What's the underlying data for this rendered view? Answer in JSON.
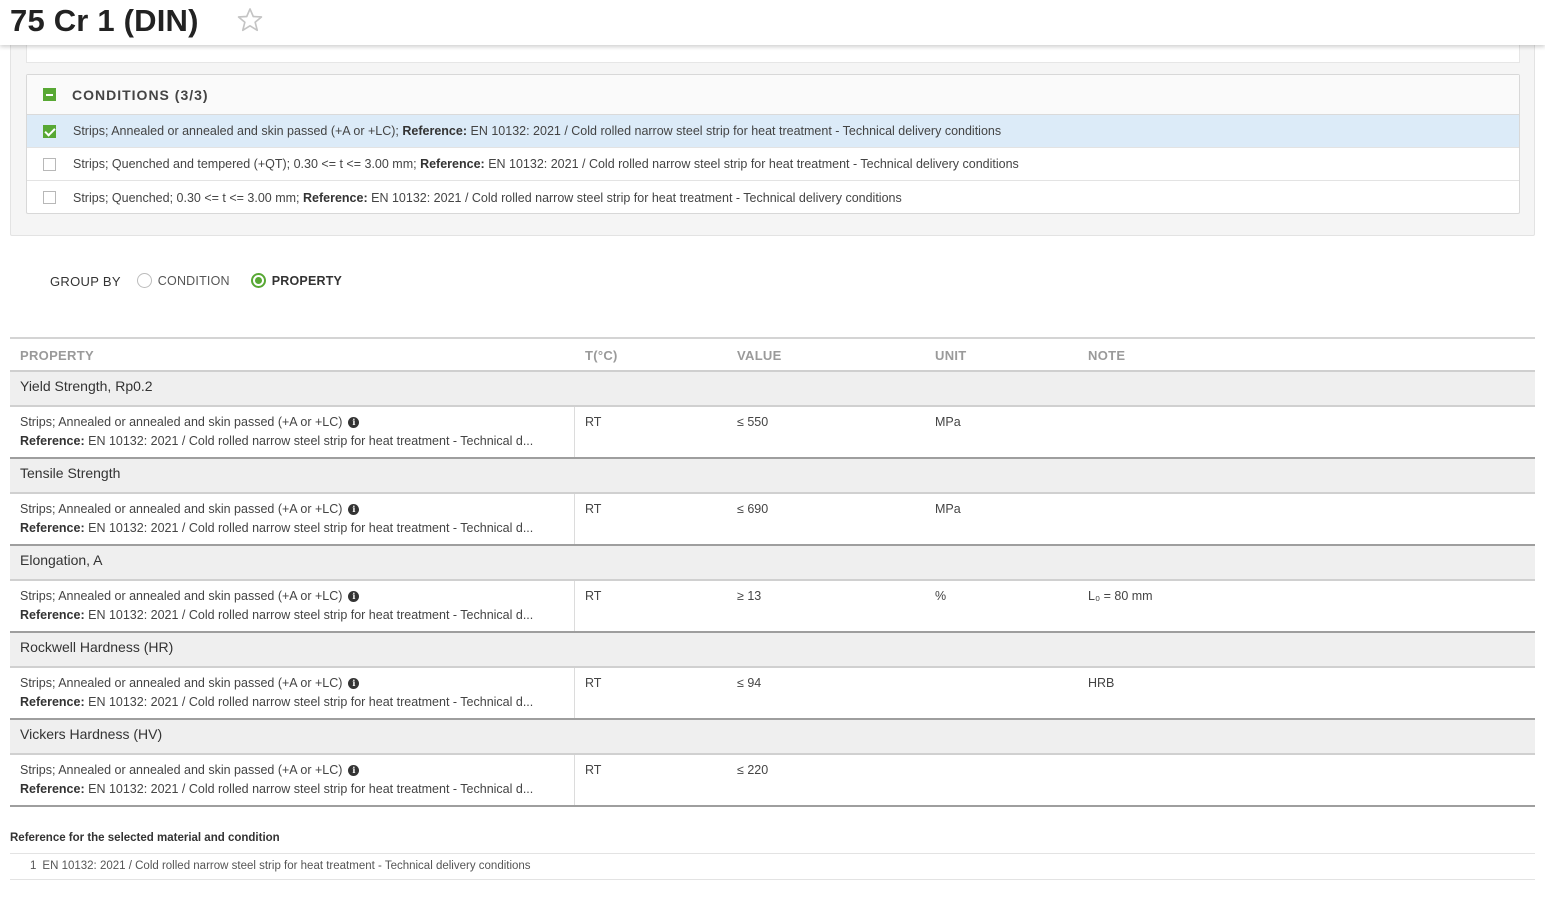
{
  "header": {
    "title": "75 Cr 1 (DIN)",
    "favorite_icon": "star-outline-icon"
  },
  "conditions": {
    "title": "CONDITIONS (3/3)",
    "reference_label": "Reference:",
    "items": [
      {
        "text": "Strips; Annealed or annealed and skin passed (+A or +LC);",
        "reference": "EN 10132: 2021 / Cold rolled narrow steel strip for heat treatment - Technical delivery conditions",
        "checked": true
      },
      {
        "text": "Strips; Quenched and tempered (+QT); 0.30 <= t <= 3.00 mm;",
        "reference": "EN 10132: 2021 / Cold rolled narrow steel strip for heat treatment - Technical delivery conditions",
        "checked": false
      },
      {
        "text": "Strips; Quenched; 0.30 <= t <= 3.00 mm;",
        "reference": "EN 10132: 2021 / Cold rolled narrow steel strip for heat treatment - Technical delivery conditions",
        "checked": false
      }
    ]
  },
  "group_by": {
    "label": "GROUP BY",
    "options": [
      "CONDITION",
      "PROPERTY"
    ],
    "selected": "PROPERTY"
  },
  "table": {
    "headers": {
      "property": "PROPERTY",
      "temp": "T(°C)",
      "value": "VALUE",
      "unit": "UNIT",
      "note": "NOTE"
    },
    "condition_text": "Strips; Annealed or annealed and skin passed (+A or +LC)",
    "reference_label": "Reference:",
    "reference_text": "EN 10132: 2021 / Cold rolled narrow steel strip for heat treatment - Technical d...",
    "groups": [
      {
        "name": "Yield Strength, Rp0.2",
        "temp": "RT",
        "value": "≤ 550",
        "unit": "MPa",
        "note": ""
      },
      {
        "name": "Tensile Strength",
        "temp": "RT",
        "value": "≤ 690",
        "unit": "MPa",
        "note": ""
      },
      {
        "name": "Elongation, A",
        "temp": "RT",
        "value": "≥ 13",
        "unit": "%",
        "note": "L₀ = 80 mm"
      },
      {
        "name": "Rockwell Hardness (HR)",
        "temp": "RT",
        "value": "≤ 94",
        "unit": "",
        "note": "HRB"
      },
      {
        "name": "Vickers Hardness (HV)",
        "temp": "RT",
        "value": "≤ 220",
        "unit": "",
        "note": ""
      }
    ]
  },
  "references": {
    "title": "Reference for the selected material and condition",
    "items": [
      {
        "num": "1",
        "text": "EN 10132: 2021 / Cold rolled narrow steel strip for heat treatment - Technical delivery conditions"
      }
    ]
  }
}
